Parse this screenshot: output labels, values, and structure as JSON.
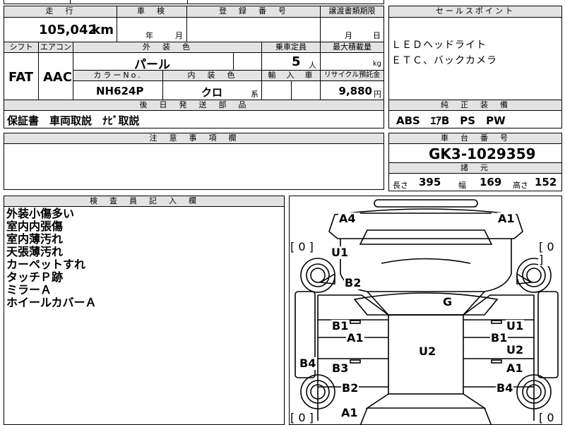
{
  "mileage": {
    "header": "走　行",
    "value": "105,042",
    "unit": "km"
  },
  "inspection": {
    "header": "車　検",
    "year_unit": "年",
    "month_unit": "月"
  },
  "registration": {
    "header": "登　録　番　号"
  },
  "transfer": {
    "header": "譲渡書類期限",
    "month_unit": "月",
    "day_unit": "日"
  },
  "sales_point": {
    "header": "セールスポイント",
    "lines": [
      "ＬＥＤヘッドライト",
      "ＥＴＣ、バックカメラ"
    ]
  },
  "shift": {
    "header": "シフト",
    "value": "FAT"
  },
  "aircon": {
    "header": "エアコン",
    "value": "AAC"
  },
  "exterior": {
    "header": "外　装　色",
    "value": "パール"
  },
  "capacity": {
    "header": "乗車定員",
    "value": "5",
    "unit": "人"
  },
  "max_load": {
    "header": "最大積載量",
    "unit": "kg"
  },
  "color_no": {
    "header": "カラーNo.",
    "value": "NH624P"
  },
  "interior": {
    "header": "内　装　色",
    "value": "クロ",
    "unit": "系"
  },
  "import": {
    "header": "輸　入　車"
  },
  "recycle": {
    "header": "リサイクル預託金",
    "value": "9,880",
    "unit": "円"
  },
  "later_parts": {
    "header": "後　日　発　送　部　品",
    "value": "保証書　車両取説　ﾅﾋﾞ取説"
  },
  "equipment": {
    "header": "純　正　装　備",
    "value": "ABS　ｴｱB　PS　PW"
  },
  "notes": {
    "header": "注　意　事　項　欄"
  },
  "chassis": {
    "header": "車　台　番　号",
    "value": "GK3-1029359"
  },
  "specs": {
    "header": "諸　元",
    "length_label": "長さ",
    "length": "395",
    "width_label": "幅",
    "width": "169",
    "height_label": "高さ",
    "height": "152"
  },
  "inspector": {
    "header": "検　査　員　記　入　欄",
    "items": [
      "外装小傷多い",
      "室内内張傷",
      "室内薄汚れ",
      "天張薄汚れ",
      "カーペットすれ",
      "タッチＰ跡",
      "ミラーＡ",
      "ホイールカバーＡ"
    ]
  },
  "diagram": {
    "tire_left_top": "[ 0 ]",
    "tire_right_top": "[ 0 ]",
    "tire_left_bottom": "[ 0 ]",
    "tire_right_bottom": "[ 0 ]",
    "marks": {
      "front_left_bumper": "A4",
      "front_right_bumper": "A1",
      "left_front_fender": "U1",
      "hood": "B2",
      "roof": "G",
      "left_front_door_1": "B1",
      "left_front_door_2": "A1",
      "right_front_door_1": "U1",
      "right_front_door_2": "B1",
      "right_rear_door_1": "U2",
      "right_rear_door_2": "A1",
      "center": "U2",
      "left_rear_door": "B3",
      "left_sill": "B4",
      "left_rear_fender": "B2",
      "right_rear_fender": "B4",
      "rear_left": "A1"
    }
  }
}
